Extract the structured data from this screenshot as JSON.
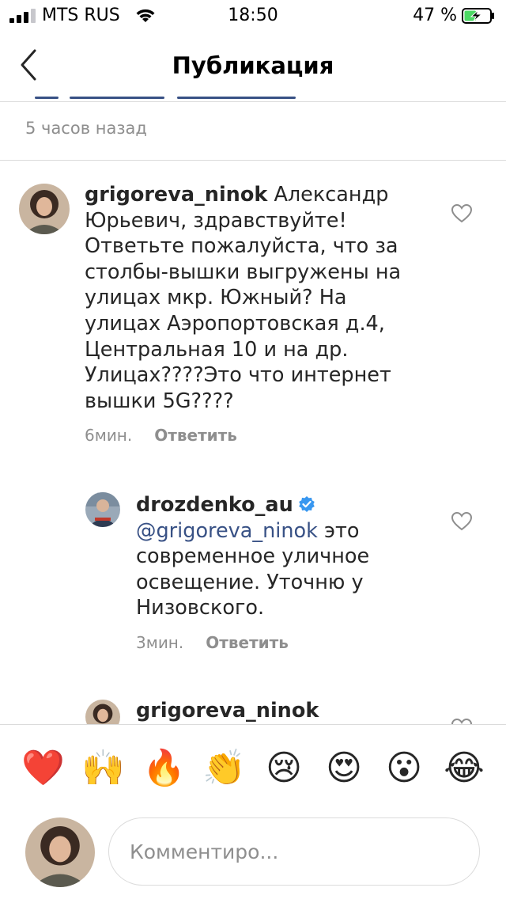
{
  "status_bar": {
    "carrier": "MTS RUS",
    "time": "18:50",
    "battery_percent": "47 %",
    "battery_level": 0.47,
    "charging": true
  },
  "nav": {
    "title": "Публикация"
  },
  "post": {
    "timestamp": "5 часов назад"
  },
  "comments": [
    {
      "username": "grigoreva_ninok",
      "lines": [
        "Александр",
        "Юрьевич, здравствуйте!",
        "Ответьте пожалуйста, что за",
        "столбы-вышки выгружены на",
        "улицах мкр. Южный? На",
        "улицах Аэропортовская д.4,",
        "Центральная 10 и на др.",
        "Улицах????Это что интернет",
        "вышки 5G????"
      ],
      "time": "6мин.",
      "reply_label": "Ответить"
    },
    {
      "username": "drozdenko_au",
      "verified": true,
      "mention": "@grigoreva_ninok",
      "lines": [
        " это",
        "современное уличное",
        "освещение. Уточню у",
        "Низовского."
      ],
      "time": "3мин.",
      "reply_label": "Ответить"
    },
    {
      "username": "grigoreva_ninok"
    }
  ],
  "emoji_bar": [
    {
      "icon": "red-heart-icon",
      "glyph": "❤️"
    },
    {
      "icon": "raising-hands-icon",
      "glyph": "🙌"
    },
    {
      "icon": "fire-icon",
      "glyph": "🔥"
    },
    {
      "icon": "clapping-hands-icon",
      "glyph": "👏"
    },
    {
      "icon": "crying-face-icon",
      "glyph": "😢"
    },
    {
      "icon": "heart-eyes-icon",
      "glyph": "😍"
    },
    {
      "icon": "surprised-face-icon",
      "glyph": "😮"
    },
    {
      "icon": "tears-of-joy-icon",
      "glyph": "😂"
    }
  ],
  "comment_input": {
    "placeholder": "Комментиро..."
  },
  "colors": {
    "link": "#385185",
    "secondary_text": "#8e8e8e",
    "divider": "#dbdbdb",
    "verified_badge": "#3897f0",
    "battery_charge": "#4cd964"
  }
}
